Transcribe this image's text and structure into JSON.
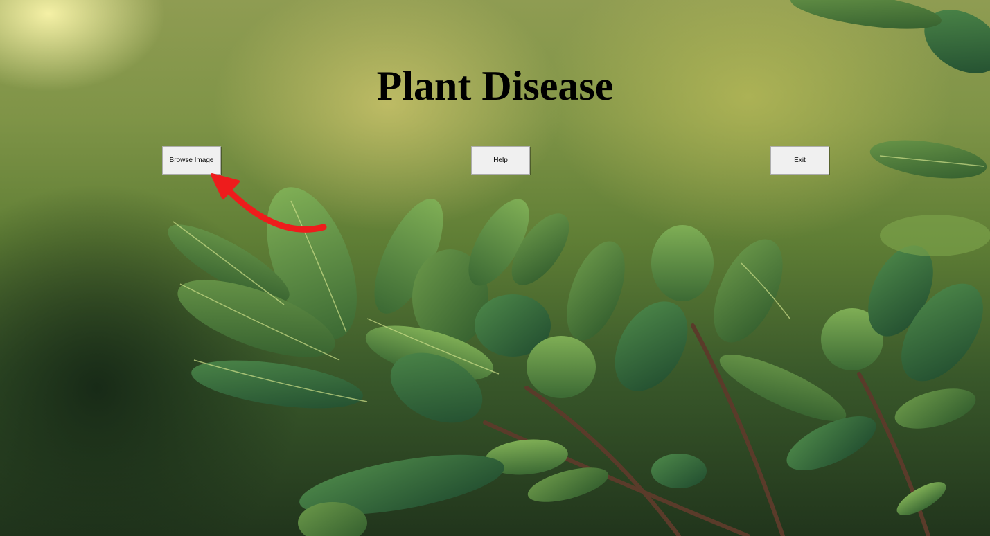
{
  "window": {
    "title": "Plant Disease"
  },
  "buttons": {
    "browse": "Browse Image",
    "help": "Help",
    "exit": "Exit"
  },
  "colors": {
    "annotation_arrow": "#ee1c1c",
    "button_face": "#f0f0f0",
    "title_text": "#000000"
  },
  "annotation": {
    "icon": "curved-arrow-icon",
    "points_to": "browse-image-button"
  }
}
